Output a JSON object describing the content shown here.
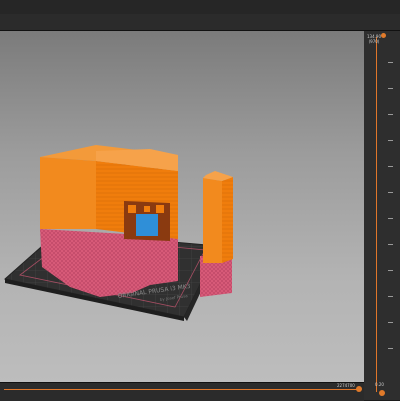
{
  "viewport": {
    "bed_label": "ORIGINAL PRUSA i3 MK3",
    "bed_sublabel": "by Josef Prusa"
  },
  "vertical_slider": {
    "top_value": "134.90",
    "top_layer": "(970)",
    "bottom_value": "0.20"
  },
  "horizontal_slider": {
    "value": "2274700"
  },
  "colors": {
    "accent": "#e0762a",
    "model_orange": "#f07d0c",
    "support_pink": "#d75a78",
    "window_blue": "#2f8fd8"
  }
}
